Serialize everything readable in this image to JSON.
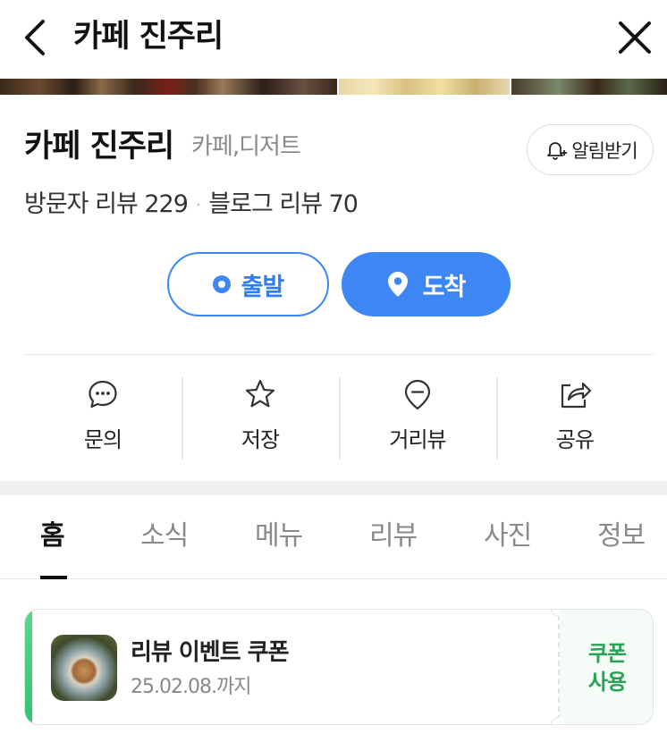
{
  "header": {
    "title": "카페 진주리"
  },
  "store": {
    "name": "카페 진주리",
    "category": "카페,디저트",
    "alarm_label": "알림받기",
    "visitor_reviews": "방문자 리뷰 229",
    "separator": "·",
    "blog_reviews": "블로그 리뷰 70"
  },
  "route": {
    "depart_label": "출발",
    "arrive_label": "도착",
    "accent_color": "#3d87f5"
  },
  "actions": [
    {
      "label": "문의",
      "icon": "chat-bubble-icon"
    },
    {
      "label": "저장",
      "icon": "star-icon"
    },
    {
      "label": "거리뷰",
      "icon": "street-view-pin-icon"
    },
    {
      "label": "공유",
      "icon": "share-icon"
    }
  ],
  "tabs": [
    {
      "label": "홈",
      "active": true
    },
    {
      "label": "소식",
      "active": false
    },
    {
      "label": "메뉴",
      "active": false
    },
    {
      "label": "리뷰",
      "active": false
    },
    {
      "label": "사진",
      "active": false
    },
    {
      "label": "정보",
      "active": false
    }
  ],
  "coupon": {
    "title": "리뷰 이벤트 쿠폰",
    "expiry": "25.02.08.까지",
    "use_label": "쿠폰 사용",
    "accent_color": "#30c472"
  }
}
